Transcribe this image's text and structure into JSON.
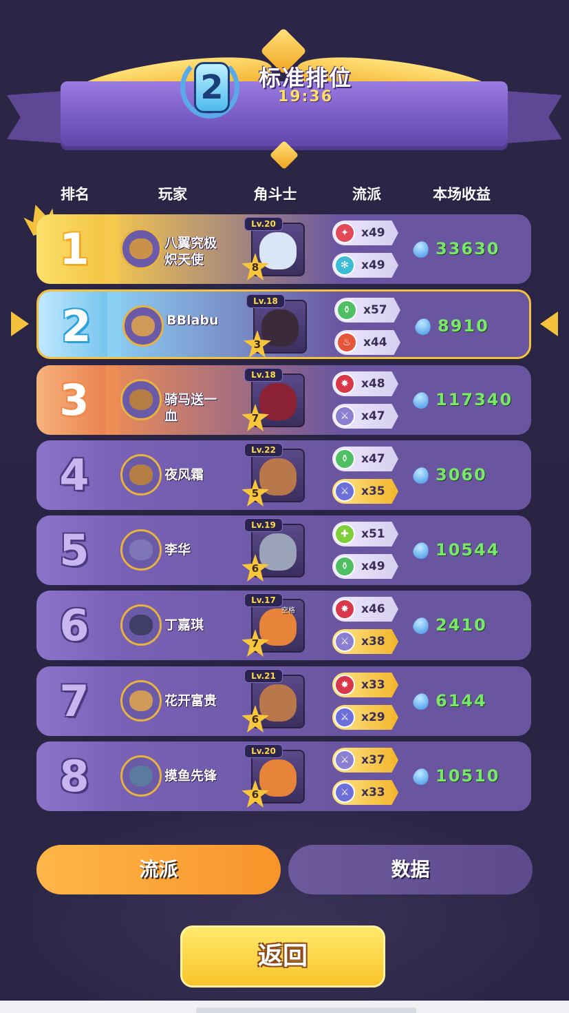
{
  "header": {
    "rank_badge": "2",
    "mode_title": "标准排位",
    "timer": "19:36"
  },
  "columns": [
    "排名",
    "玩家",
    "角斗士",
    "流派",
    "本场收益"
  ],
  "colors": {
    "rank1": "#f6c94a",
    "rank2": "#7cc9f2",
    "rank3": "#f09a56",
    "default_rank": "#7e65b9",
    "earnings": "#79e86a",
    "active_tab": "#f7a43a"
  },
  "rows": [
    {
      "rank": "1",
      "player": "八翼究极炽天使",
      "hero_level": "Lv.20",
      "hero_stars": "8",
      "hero_tag": "",
      "styles": [
        {
          "icon": "blade-icon",
          "color": "#e24a5a",
          "count": "x49",
          "pill": "light"
        },
        {
          "icon": "snowflake-icon",
          "color": "#3dbcd6",
          "count": "x49",
          "pill": "light"
        }
      ],
      "earnings": "33630"
    },
    {
      "rank": "2",
      "player": "BBlabu",
      "hero_level": "Lv.18",
      "hero_stars": "3",
      "hero_tag": "",
      "styles": [
        {
          "icon": "potion-icon",
          "color": "#4fbf63",
          "count": "x57",
          "pill": "light"
        },
        {
          "icon": "flame-icon",
          "color": "#e5553a",
          "count": "x44",
          "pill": "light"
        }
      ],
      "earnings": "8910"
    },
    {
      "rank": "3",
      "player": "骑马送一血",
      "hero_level": "Lv.18",
      "hero_stars": "7",
      "hero_tag": "",
      "styles": [
        {
          "icon": "burst-icon",
          "color": "#d9384a",
          "count": "x48",
          "pill": "light"
        },
        {
          "icon": "sword-icon",
          "color": "#8a7fd0",
          "count": "x47",
          "pill": "light"
        }
      ],
      "earnings": "117340"
    },
    {
      "rank": "4",
      "player": "夜风霜",
      "hero_level": "Lv.22",
      "hero_stars": "5",
      "hero_tag": "",
      "styles": [
        {
          "icon": "potion-icon",
          "color": "#4fbf63",
          "count": "x47",
          "pill": "light"
        },
        {
          "icon": "sword-icon",
          "color": "#6c6fd8",
          "count": "x35",
          "pill": "gold"
        }
      ],
      "earnings": "3060"
    },
    {
      "rank": "5",
      "player": "李华",
      "hero_level": "Lv.19",
      "hero_stars": "6",
      "hero_tag": "",
      "styles": [
        {
          "icon": "heal-icon",
          "color": "#7fcf3a",
          "count": "x51",
          "pill": "light"
        },
        {
          "icon": "potion-icon",
          "color": "#4fbf63",
          "count": "x49",
          "pill": "light"
        }
      ],
      "earnings": "10544"
    },
    {
      "rank": "6",
      "player": "丁嘉琪",
      "hero_level": "Lv.17",
      "hero_stars": "7",
      "hero_tag": "空格",
      "styles": [
        {
          "icon": "burst-icon",
          "color": "#d9384a",
          "count": "x46",
          "pill": "light"
        },
        {
          "icon": "sword-icon",
          "color": "#8a7fd0",
          "count": "x38",
          "pill": "gold"
        }
      ],
      "earnings": "2410"
    },
    {
      "rank": "7",
      "player": "花开富贵",
      "hero_level": "Lv.21",
      "hero_stars": "6",
      "hero_tag": "",
      "styles": [
        {
          "icon": "burst-icon",
          "color": "#d9384a",
          "count": "x33",
          "pill": "gold"
        },
        {
          "icon": "sword-icon",
          "color": "#6c6fd8",
          "count": "x29",
          "pill": "gold"
        }
      ],
      "earnings": "6144"
    },
    {
      "rank": "8",
      "player": "摸鱼先锋",
      "hero_level": "Lv.20",
      "hero_stars": "6",
      "hero_tag": "",
      "styles": [
        {
          "icon": "sword-icon",
          "color": "#8a7fd0",
          "count": "x37",
          "pill": "gold"
        },
        {
          "icon": "sword-icon",
          "color": "#6c6fd8",
          "count": "x33",
          "pill": "gold"
        }
      ],
      "earnings": "10510"
    }
  ],
  "tabs": {
    "styles": "流派",
    "data": "数据"
  },
  "back_button": "返回"
}
